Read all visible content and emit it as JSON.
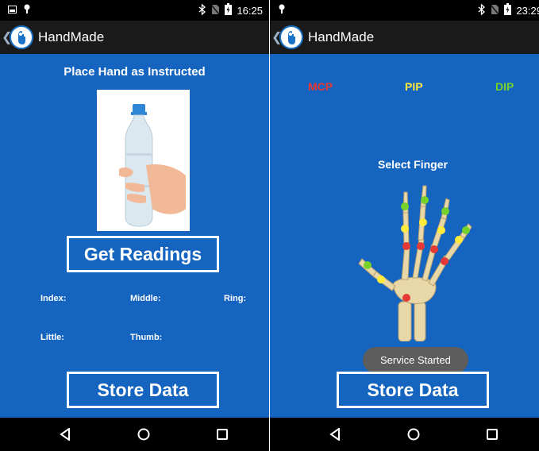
{
  "left_screen": {
    "status": {
      "time": "16:25"
    },
    "app_title": "HandMade",
    "instruction": "Place Hand as Instructed",
    "get_readings_label": "Get Readings",
    "readings": {
      "index": "Index:",
      "middle": "Middle:",
      "ring": "Ring:",
      "little": "Little:",
      "thumb": "Thumb:"
    },
    "store_label": "Store Data"
  },
  "right_screen": {
    "status": {
      "time": "23:29"
    },
    "app_title": "HandMade",
    "legend": {
      "mcp": "MCP",
      "pip": "PIP",
      "dip": "DIP"
    },
    "select_label": "Select Finger",
    "toast": "Service Started",
    "store_label": "Store Data"
  },
  "colors": {
    "background": "#1565c0",
    "mcp": "#e53935",
    "pip": "#ffeb3b",
    "dip": "#76d12a"
  },
  "icons": {
    "status_left": [
      "image-icon",
      "android-debug-icon"
    ],
    "status_right": [
      "bluetooth-icon",
      "no-sim-icon",
      "battery-charging-icon"
    ],
    "nav": [
      "back-triangle-icon",
      "home-circle-icon",
      "recents-square-icon"
    ]
  }
}
